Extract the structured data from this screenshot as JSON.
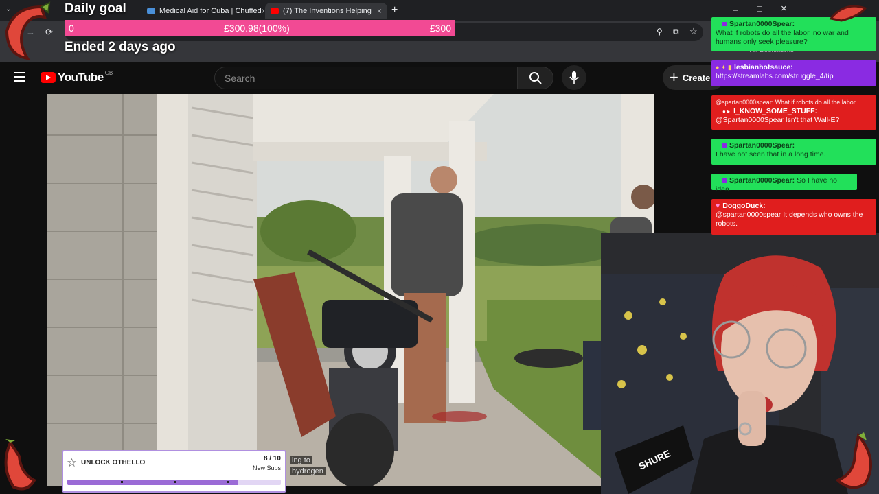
{
  "browser": {
    "tabs": [
      {
        "label": "Medical Aid for Cuba | Chuffed",
        "icon_color": "#4a90d9"
      },
      {
        "label": "(7) The Inventions Helping",
        "icon_color": "#ff0000",
        "active": true
      }
    ],
    "new_tab": "+",
    "close_glyph": "×",
    "win_min": "–",
    "win_max": "□",
    "win_close": "×",
    "bookmark_text": "All Bookmarks"
  },
  "youtube": {
    "logo_text": "YouTube",
    "region": "GB",
    "search_placeholder": "Search",
    "create_label": "Create"
  },
  "goal": {
    "title": "Daily goal",
    "start": "0",
    "current": "£300.98(100%)",
    "target": "£300",
    "progress": 1.0,
    "status": "Ended 2 days ago",
    "color": "#f24a94"
  },
  "chat": [
    {
      "name": "Spartan0000Spear:",
      "text": "What if robots do all the labor, no war and humans only seek pleasure?",
      "bg": "#22e05a",
      "color": "#0d3d18"
    },
    {
      "name": "lesbianhotsauce:",
      "text": "https://streamlabs.com/struggle_4/tip",
      "bg": "#8a2be2",
      "color": "#ffffff"
    },
    {
      "reply": "@spartan0000spear: What if robots do all the labor,...",
      "name": "I_KNOW_SOME_STUFF:",
      "text": "@Spartan0000Spear Isn't that Wall-E?",
      "bg": "#e01e1e",
      "color": "#ffffff"
    },
    {
      "name": "Spartan0000Spear:",
      "text": "I have not seen that in a long time.",
      "bg": "#22e05a",
      "color": "#0d3d18"
    },
    {
      "name": "Spartan0000Spear:",
      "text": "So I have no idea.",
      "bg": "#22e05a",
      "color": "#0d3d18"
    },
    {
      "name": "DoggoDuck:",
      "text": "@spartan0000spear It depends who owns the robots.",
      "bg": "#e01e1e",
      "color": "#ffffff"
    }
  ],
  "unlock": {
    "title": "UNLOCK OTHELLO",
    "count": "8 / 10",
    "unit": "New Subs",
    "progress": 0.8,
    "color": "#9b6bd6"
  },
  "captions": [
    "ing to",
    "hydrogen"
  ]
}
